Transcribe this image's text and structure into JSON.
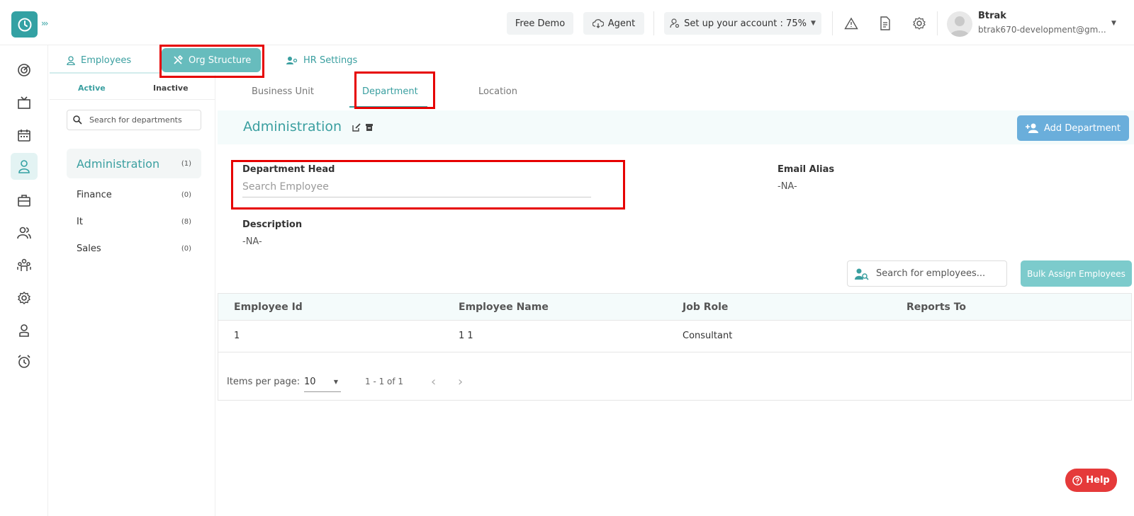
{
  "topbar": {
    "free_demo": "Free Demo",
    "agent": "Agent",
    "setup": "Set up your account : 75%",
    "user_name": "Btrak",
    "user_email": "btrak670-development@gm..."
  },
  "tabs": {
    "employees": "Employees",
    "org_structure": "Org Structure",
    "hr_settings": "HR Settings"
  },
  "left": {
    "active_tab": "Active",
    "inactive_tab": "Inactive",
    "search_placeholder": "Search for departments",
    "departments": [
      {
        "name": "Administration",
        "count": "(1)"
      },
      {
        "name": "Finance",
        "count": "(0)"
      },
      {
        "name": "It",
        "count": "(8)"
      },
      {
        "name": "Sales",
        "count": "(0)"
      }
    ]
  },
  "subtabs": {
    "business_unit": "Business Unit",
    "department": "Department",
    "location": "Location"
  },
  "detail": {
    "title": "Administration",
    "add_button": "Add Department",
    "dept_head_label": "Department Head",
    "dept_head_placeholder": "Search Employee",
    "email_alias_label": "Email Alias",
    "email_alias_value": "-NA-",
    "description_label": "Description",
    "description_value": "-NA-",
    "emp_search_placeholder": "Search for employees...",
    "bulk_assign": "Bulk Assign Employees"
  },
  "table": {
    "headers": [
      "Employee Id",
      "Employee Name",
      "Job Role",
      "Reports To"
    ],
    "rows": [
      {
        "id": "1",
        "name": "1 1",
        "role": "Consultant",
        "reports_to": ""
      }
    ],
    "items_per_page_label": "Items per page:",
    "items_per_page_value": "10",
    "range": "1 - 1 of 1"
  },
  "help": "Help",
  "colors": {
    "accent": "#3a9fa0",
    "highlight": "#e60000",
    "add_button": "#6aaedb"
  }
}
